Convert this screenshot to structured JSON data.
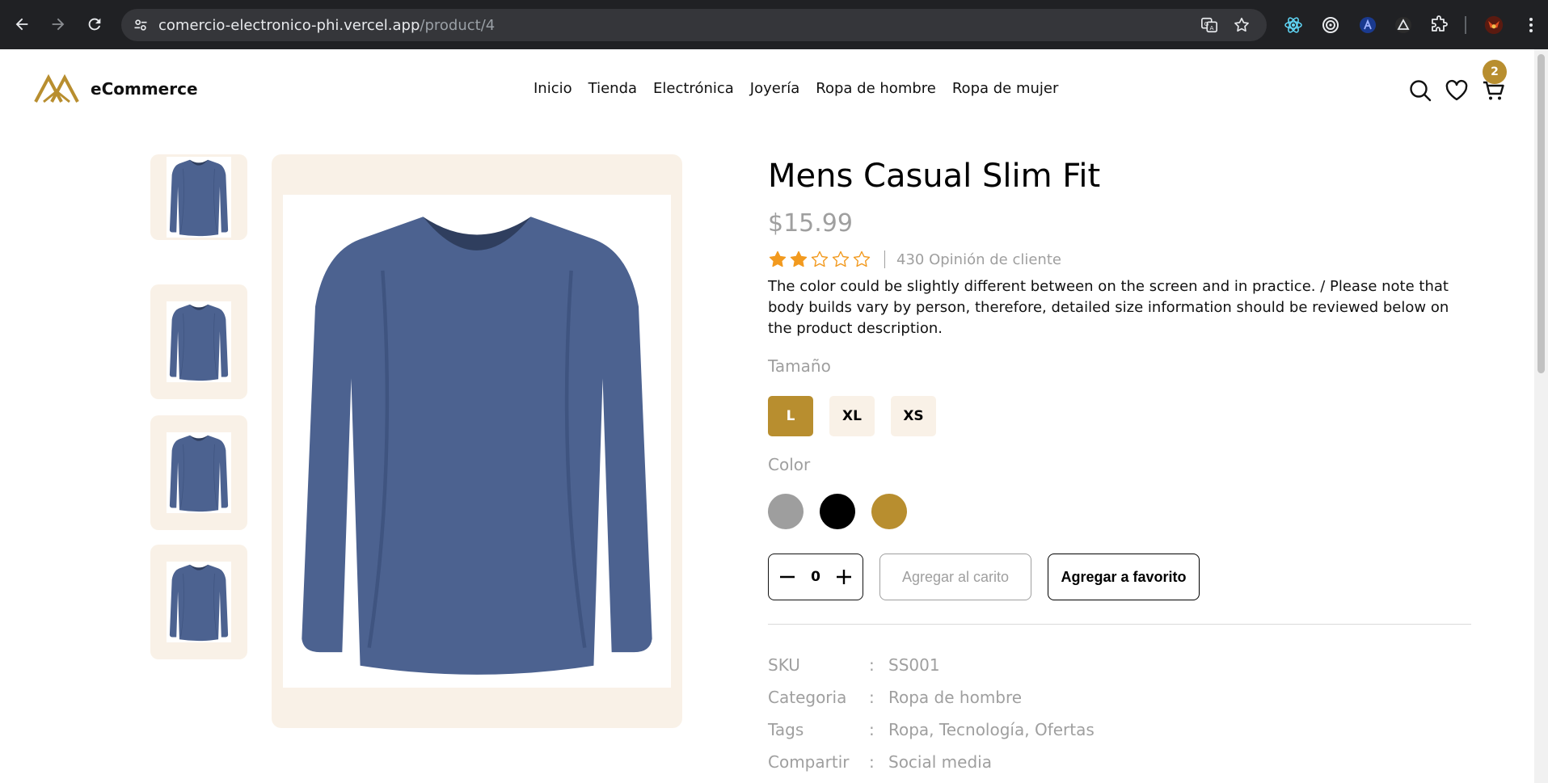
{
  "browser": {
    "url_host": "comercio-electronico-phi.vercel.app",
    "url_path": "/product/4"
  },
  "site": {
    "brand": "eCommerce",
    "accent_color": "#b88e2f",
    "nav": [
      "Inicio",
      "Tienda",
      "Electrónica",
      "Joyería",
      "Ropa de hombre",
      "Ropa de mujer"
    ],
    "cart_count": "2"
  },
  "product": {
    "title": "Mens Casual Slim Fit",
    "price": "$15.99",
    "rating": 2,
    "rating_max": 5,
    "reviews": "430 Opinión de cliente",
    "description": "The color could be slightly different between on the screen and in practice. / Please note that body builds vary by person, therefore, detailed size information should be reviewed below on the product description.",
    "size_label": "Tamaño",
    "sizes": [
      "L",
      "XL",
      "XS"
    ],
    "selected_size": "L",
    "color_label": "Color",
    "colors": [
      "#9e9e9e",
      "#000000",
      "#b88e2f"
    ],
    "quantity": "0",
    "add_to_cart": "Agregar al carito",
    "add_to_favorite": "Agregar a favorito",
    "meta": [
      {
        "key": "SKU",
        "sep": ":",
        "value": "SS001"
      },
      {
        "key": "Categoria",
        "sep": ":",
        "value": "Ropa de hombre"
      },
      {
        "key": "Tags",
        "sep": ":",
        "value": "Ropa, Tecnología, Ofertas"
      },
      {
        "key": "Compartir",
        "sep": ":",
        "value": "Social media"
      }
    ]
  }
}
